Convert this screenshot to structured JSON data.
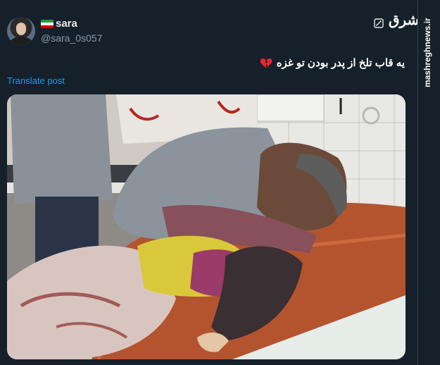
{
  "post": {
    "display_name": "sara",
    "handle": "@sara_0s057",
    "text": "یه قاب تلخ از پدر بودن تو غزه",
    "translate_label": "Translate post",
    "emoji_icon": "broken-heart-icon",
    "flag_icon": "iran-flag-icon"
  },
  "branding": {
    "logo_text": "مشرق",
    "site_url": "mashreghnews.ir"
  },
  "colors": {
    "background": "#15202b",
    "link": "#1d9bf0",
    "handle": "#8b98a5",
    "text": "#e7e9ea"
  }
}
